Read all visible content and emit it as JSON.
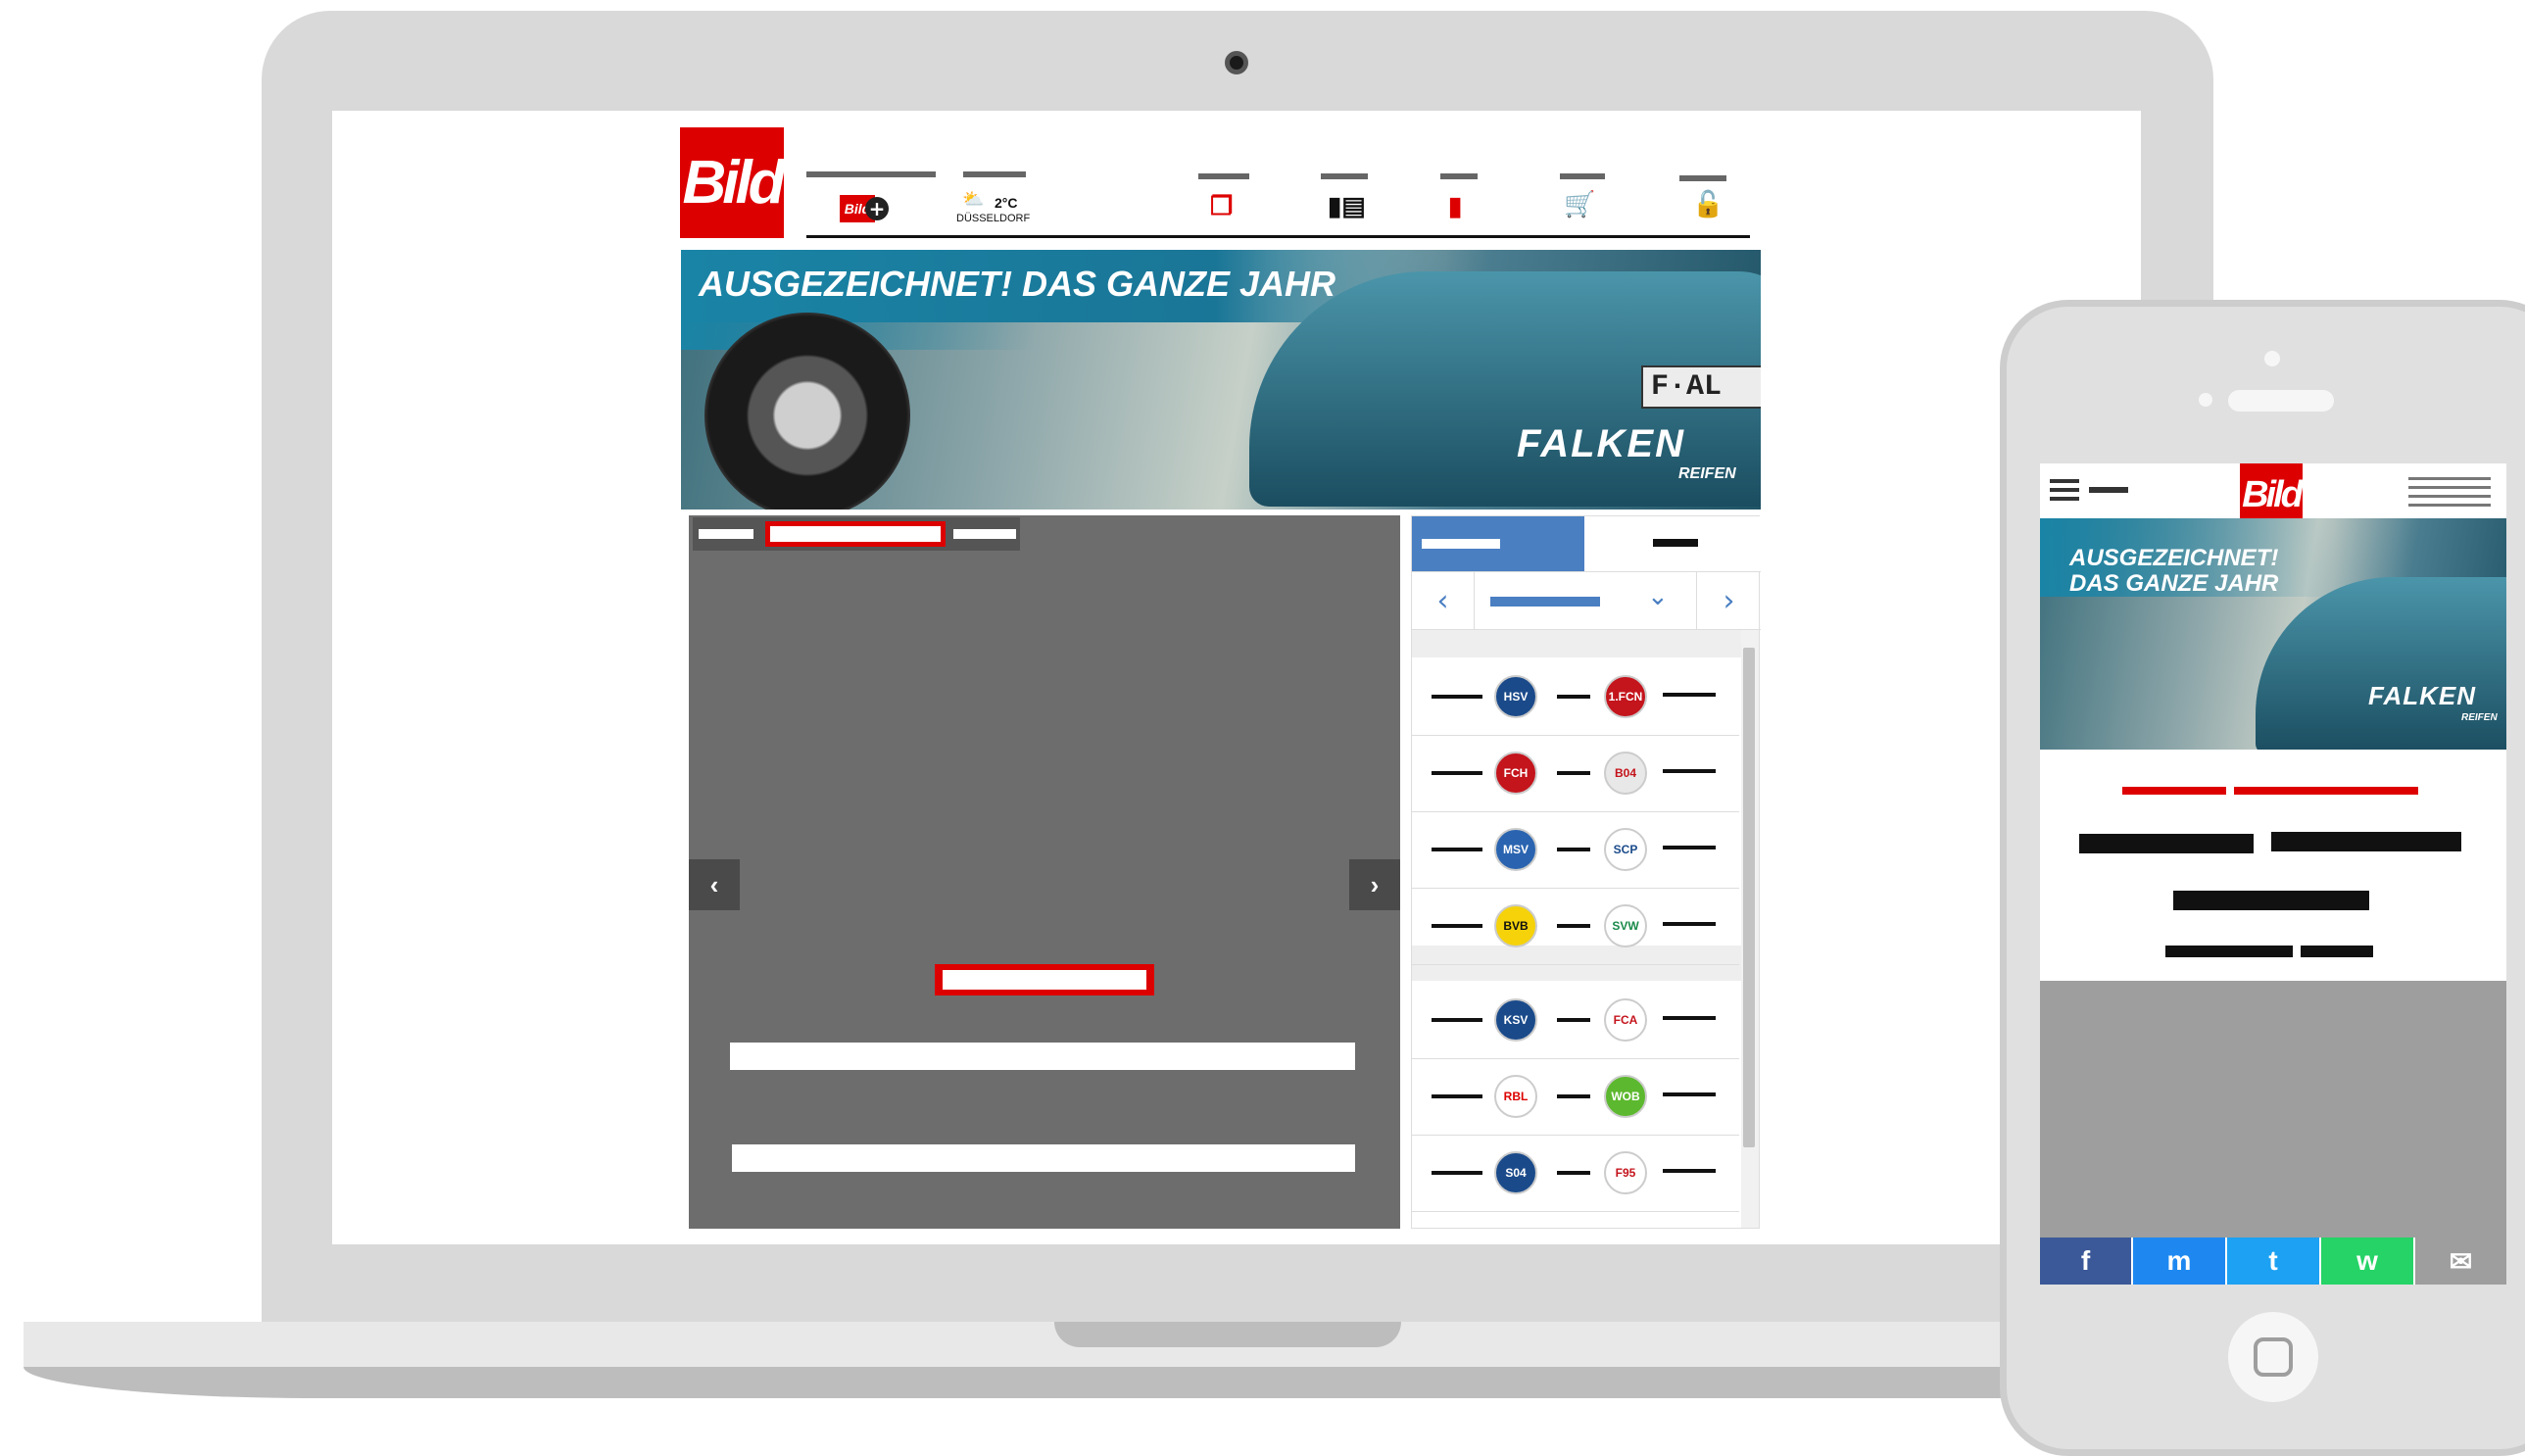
{
  "header": {
    "logo_text": "Bild",
    "plus_logo_text": "Bild",
    "weather": {
      "temp": "2°C",
      "city": "DÜSSELDORF"
    }
  },
  "banner": {
    "headline": "AUSGEZEICHNET! DAS GANZE JAHR",
    "plate": "F·AL",
    "brand": "FALKEN",
    "brand_sub": "REIFEN"
  },
  "slideshow": {
    "prev": "‹",
    "next": "›"
  },
  "scores": {
    "matches": [
      {
        "home": "HSV",
        "away": "1.FCN"
      },
      {
        "home": "FCH",
        "away": "B04"
      },
      {
        "home": "MSV",
        "away": "SCP"
      },
      {
        "home": "BVB",
        "away": "SVW"
      },
      {
        "home": "KSV",
        "away": "FCA"
      },
      {
        "home": "RBL",
        "away": "WOB"
      },
      {
        "home": "S04",
        "away": "F95"
      }
    ]
  },
  "phone": {
    "logo_text": "Bild",
    "banner_line1": "AUSGEZEICHNET!",
    "banner_line2": "DAS GANZE JAHR",
    "brand": "FALKEN",
    "brand_sub": "REIFEN",
    "share": [
      "f",
      "m",
      "t",
      "w",
      "✉"
    ]
  },
  "colors": {
    "bild_red": "#dd0000",
    "scores_blue": "#4a7fc2"
  }
}
